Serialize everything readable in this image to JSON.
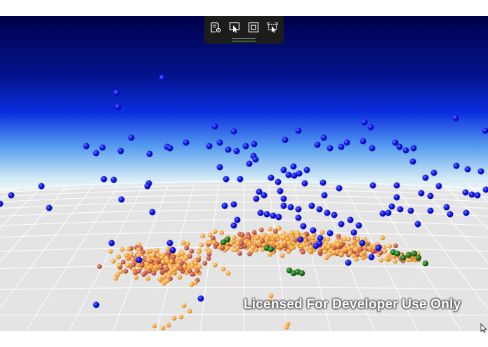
{
  "toolbar": {
    "buttons": [
      {
        "name": "chart-settings-icon",
        "tooltip": ""
      },
      {
        "name": "select-pointer-icon",
        "tooltip": ""
      },
      {
        "name": "zoom-extents-icon",
        "tooltip": ""
      },
      {
        "name": "rotate-select-icon",
        "tooltip": ""
      }
    ]
  },
  "watermark": {
    "text": "Licensed For Developer Use Only"
  },
  "colors": {
    "sky_top": "#00004a",
    "sky_mid": "#0a1fd6",
    "sky_horizon": "#cfe8f5",
    "floor": "#e6e6e6",
    "floor_grid": "#ffffff",
    "series_blue": "#0a10e0",
    "series_orange": "#f5a640",
    "series_red": "#c85a46",
    "series_green": "#1b6b1b"
  },
  "chart_data": {
    "type": "scatter",
    "dimensions": 3,
    "series": [
      {
        "color": "#0a10e0",
        "marker": "sphere",
        "values": []
      },
      {
        "color": "#f5a640",
        "marker": "sphere",
        "values": []
      },
      {
        "color": "#c85a46",
        "marker": "sphere",
        "values": []
      },
      {
        "color": "#1b6b1b",
        "marker": "sphere",
        "values": []
      }
    ],
    "title": "",
    "xlabel": "",
    "ylabel": "",
    "zlabel": "",
    "grid": true,
    "legend": "none"
  }
}
